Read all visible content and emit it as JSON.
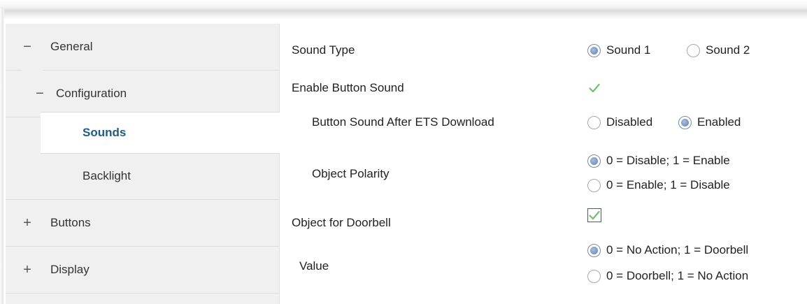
{
  "sidebar": {
    "items": [
      {
        "symbol": "−",
        "label": "General"
      },
      {
        "symbol": "−",
        "label": "Configuration"
      },
      {
        "symbol": "",
        "label": "Sounds"
      },
      {
        "symbol": "",
        "label": "Backlight"
      },
      {
        "symbol": "+",
        "label": "Buttons"
      },
      {
        "symbol": "+",
        "label": "Display"
      }
    ]
  },
  "params": {
    "sound_type": {
      "label": "Sound Type",
      "options": [
        "Sound 1",
        "Sound 2"
      ],
      "selected": "Sound 1"
    },
    "enable_button_sound": {
      "label": "Enable Button Sound",
      "checked": true
    },
    "button_sound_after_ets": {
      "label": "Button Sound After ETS Download",
      "options": [
        "Disabled",
        "Enabled"
      ],
      "selected": "Enabled"
    },
    "object_polarity": {
      "label": "Object Polarity",
      "options": [
        "0 = Disable; 1 = Enable",
        "0 = Enable; 1 = Disable"
      ],
      "selected": "0 = Disable; 1 = Enable"
    },
    "object_for_doorbell": {
      "label": "Object for Doorbell",
      "checked": true
    },
    "value": {
      "label": "Value",
      "options": [
        "0 = No Action; 1 = Doorbell",
        "0 = Doorbell; 1 = No Action"
      ],
      "selected": "0 = No Action; 1 = Doorbell"
    }
  },
  "colors": {
    "selected_text": "#1f5a8c",
    "check_green": "#4caf50",
    "radio_fill": "#5b7db8"
  }
}
